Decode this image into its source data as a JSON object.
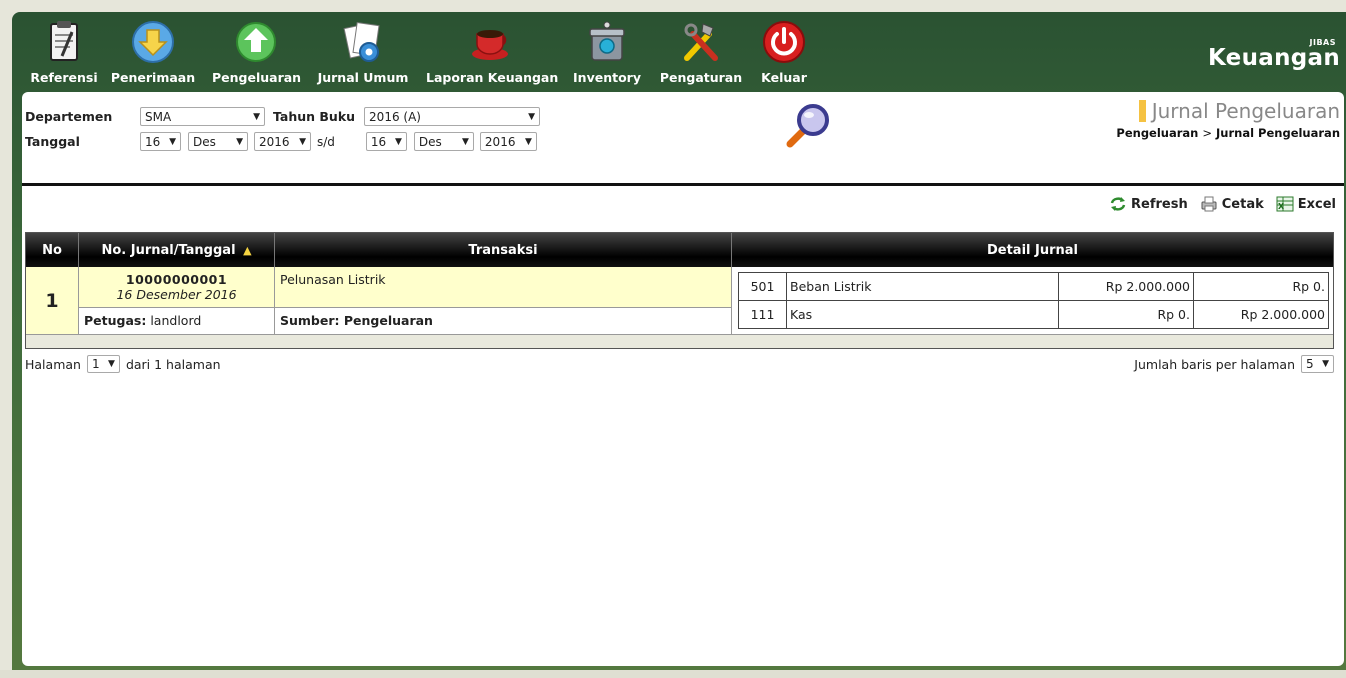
{
  "toolbar": {
    "items": [
      {
        "label": "Referensi",
        "icon": "clipboard-icon"
      },
      {
        "label": "Penerimaan",
        "icon": "arrow-down-circle-icon"
      },
      {
        "label": "Pengeluaran",
        "icon": "arrow-up-circle-icon"
      },
      {
        "label": "Jurnal Umum",
        "icon": "documents-gear-icon"
      },
      {
        "label": "Laporan Keuangan",
        "icon": "coffee-cup-icon"
      },
      {
        "label": "Inventory",
        "icon": "inventory-bin-icon"
      },
      {
        "label": "Pengaturan",
        "icon": "tools-icon"
      },
      {
        "label": "Keluar",
        "icon": "power-icon"
      }
    ]
  },
  "brand": {
    "small": "JIBAS",
    "big": "Keuangan"
  },
  "filters": {
    "departemen_label": "Departemen",
    "departemen_value": "SMA",
    "tahun_buku_label": "Tahun Buku",
    "tahun_buku_value": "2016 (A)",
    "tanggal_label": "Tanggal",
    "from_day": "16",
    "from_month": "Des",
    "from_year": "2016",
    "sd": "s/d",
    "to_day": "16",
    "to_month": "Des",
    "to_year": "2016"
  },
  "page": {
    "title": "Jurnal Pengeluaran",
    "breadcrumb_parent": "Pengeluaran",
    "breadcrumb_sep": ">",
    "breadcrumb_current": "Jurnal Pengeluaran"
  },
  "actions": {
    "refresh": "Refresh",
    "cetak": "Cetak",
    "excel": "Excel"
  },
  "table": {
    "headers": {
      "no": "No",
      "jurnal": "No. Jurnal/Tanggal",
      "transaksi": "Transaksi",
      "detail": "Detail Jurnal"
    },
    "rows": [
      {
        "no": "1",
        "jurnal_no": "10000000001",
        "tanggal": "16 Desember 2016",
        "petugas_label": "Petugas:",
        "petugas": "landlord",
        "transaksi": "Pelunasan Listrik",
        "sumber": "Sumber: Pengeluaran",
        "detail": [
          {
            "code": "501",
            "name": "Beban Listrik",
            "debit": "Rp 2.000.000",
            "kredit": "Rp 0."
          },
          {
            "code": "111",
            "name": "Kas",
            "debit": "Rp 0.",
            "kredit": "Rp 2.000.000"
          }
        ]
      }
    ]
  },
  "pager": {
    "halaman_label": "Halaman",
    "page_value": "1",
    "dari": "dari 1 halaman",
    "rows_label": "Jumlah baris per halaman",
    "rows_value": "5"
  }
}
